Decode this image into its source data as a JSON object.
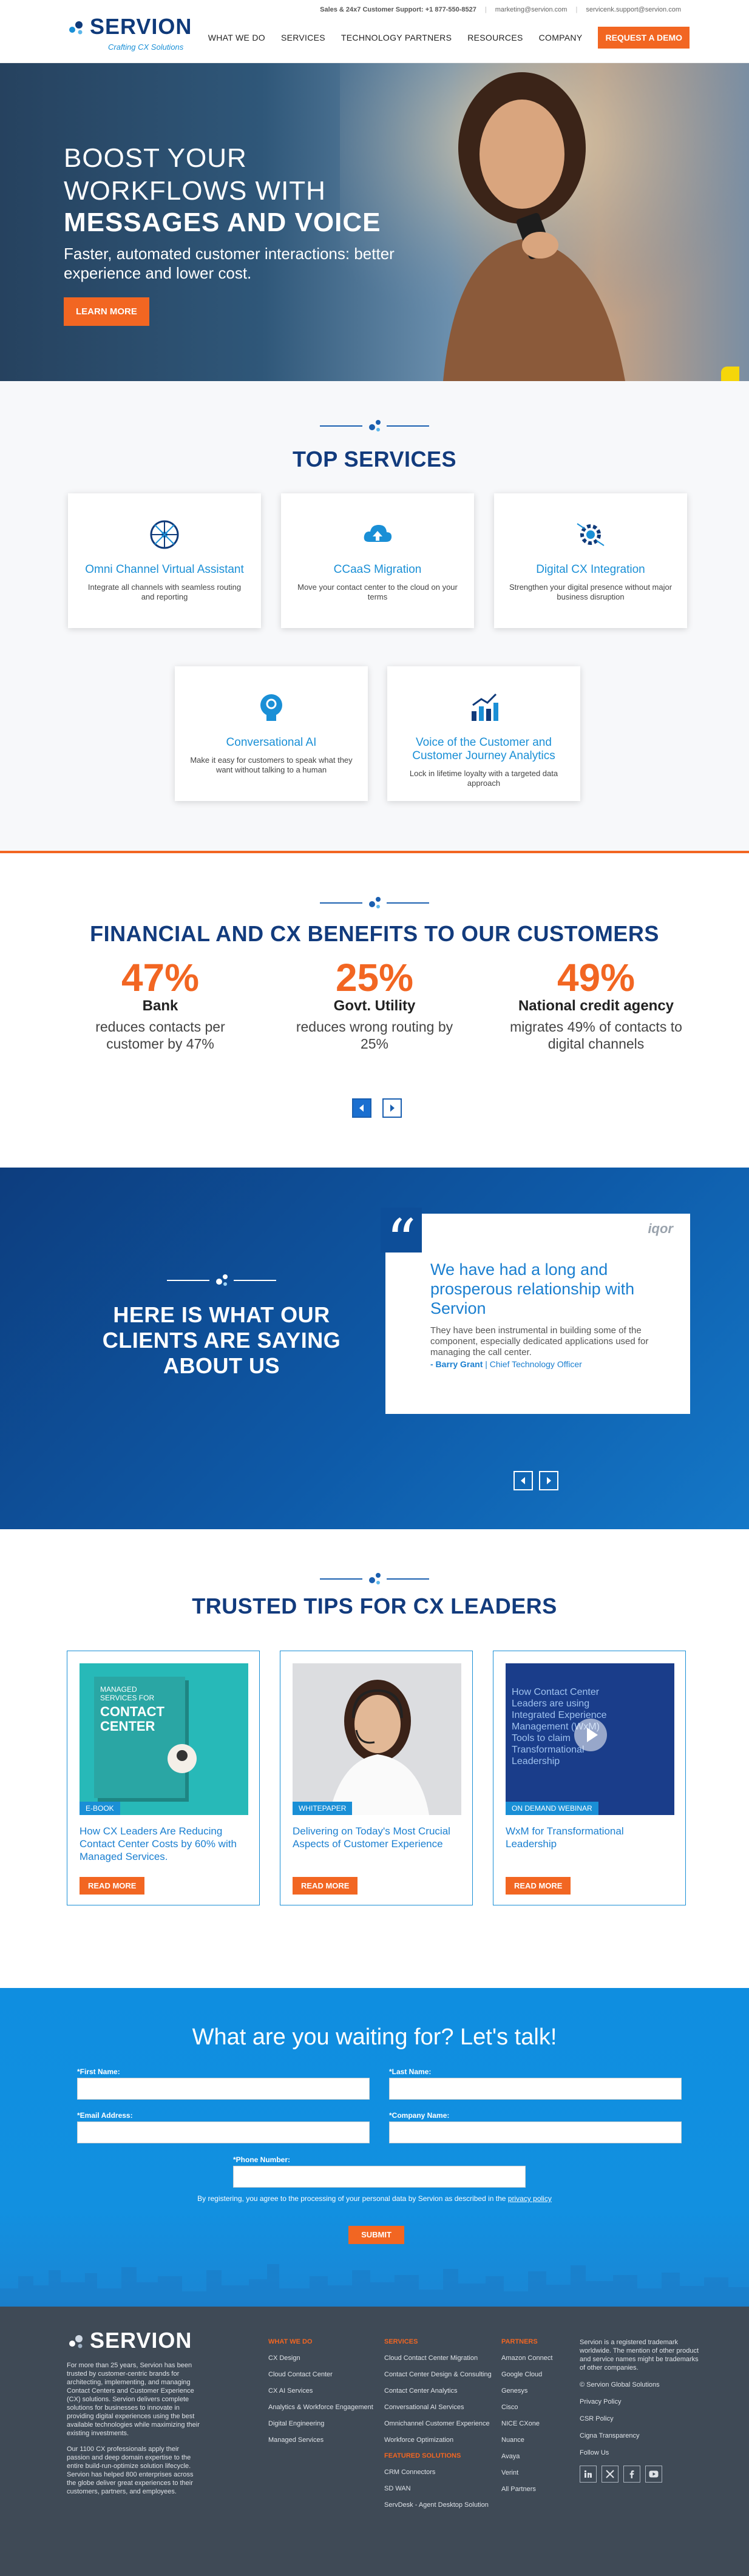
{
  "header": {
    "brand": "SERVION",
    "tagline": "Crafting CX Solutions",
    "topbar": {
      "sales": "Sales & 24x7 Customer Support: +1 877-550-8527",
      "email": "marketing@servion.com",
      "support_email": "servicenk.support@servion.com"
    },
    "nav": [
      "WHAT WE DO",
      "SERVICES",
      "TECHNOLOGY PARTNERS",
      "RESOURCES",
      "COMPANY"
    ],
    "cta": "REQUEST A DEMO"
  },
  "hero": {
    "line1a": "BOOST YOUR",
    "line1b": "WORKFLOWS WITH",
    "line2": "MESSAGES AND VOICE",
    "subtitle": "Faster, automated customer interactions: better experience and lower cost.",
    "button": "LEARN MORE"
  },
  "services": {
    "title": "TOP SERVICES",
    "items": [
      {
        "title": "Omni Channel Virtual Assistant",
        "desc": "Integrate all channels with seamless routing and reporting",
        "icon": "network-globe-icon"
      },
      {
        "title": "CCaaS Migration",
        "desc": "Move your contact center to the cloud on your terms",
        "icon": "cloud-upload-icon"
      },
      {
        "title": "Digital CX Integration",
        "desc": "Strengthen your digital presence without major business disruption",
        "icon": "gear-circuit-icon"
      },
      {
        "title": "Conversational AI",
        "desc": "Make it easy for customers to speak what they want without talking to a human",
        "icon": "ai-head-icon"
      },
      {
        "title": "Voice of the Customer and Customer Journey Analytics",
        "desc": "Lock in lifetime loyalty with a targeted data approach",
        "icon": "analytics-chart-icon"
      }
    ]
  },
  "benefits": {
    "title": "FINANCIAL AND CX BENEFITS TO OUR CUSTOMERS",
    "items": [
      {
        "pct": "47%",
        "name": "Bank",
        "desc": "reduces contacts per customer by 47%"
      },
      {
        "pct": "25%",
        "name": "Govt. Utility",
        "desc": "reduces wrong routing by 25%"
      },
      {
        "pct": "49%",
        "name": "National credit agency",
        "desc": "migrates 49% of contacts to digital channels"
      }
    ]
  },
  "testimonials": {
    "title": "HERE IS WHAT OUR CLIENTS ARE SAYING ABOUT US",
    "logo": "iqor",
    "headline": "We have had a long and prosperous relationship with Servion",
    "body": "They have been instrumental in building some of the component, especially dedicated applications used for managing the call center.",
    "author": "- Barry Grant",
    "role": "Chief Technology Officer"
  },
  "tips": {
    "title": "TRUSTED TIPS FOR CX LEADERS",
    "items": [
      {
        "badge": "E-BOOK",
        "title": "How CX Leaders Are Reducing Contact Center Costs by 60% with Managed Services.",
        "button": "READ MORE",
        "cover_l1": "MANAGED",
        "cover_l2": "SERVICES FOR",
        "cover_l3": "CONTACT",
        "cover_l4": "CENTER"
      },
      {
        "badge": "WHITEPAPER",
        "title": "Delivering on Today's Most Crucial Aspects of Customer Experience",
        "button": "READ MORE"
      },
      {
        "badge": "ON DEMAND WEBINAR",
        "title": "WxM for Transformational Leadership",
        "button": "READ MORE",
        "video_l1": "How Contact Center",
        "video_l2": "Leaders are using",
        "video_l3": "Integrated Experience",
        "video_l4": "Management (WxM)",
        "video_l5": "Tools to claim",
        "video_l6": "Transformational",
        "video_l7": "Leadership"
      }
    ]
  },
  "contact": {
    "title": "What are you waiting for? Let's talk!",
    "first_name": "*First Name:",
    "last_name": "*Last Name:",
    "email": "*Email Address:",
    "company": "*Company Name:",
    "phone": "*Phone Number:",
    "consent": "By registering, you agree to the processing of your personal data by Servion as described in the",
    "consent_link": "privacy policy",
    "submit": "SUBMIT"
  },
  "footer": {
    "brand": "SERVION",
    "about1": "For more than 25 years, Servion has been trusted by customer-centric brands for architecting, implementing, and managing Contact Centers and Customer Experience (CX) solutions. Servion delivers complete solutions for businesses to innovate in providing digital experiences using the best available technologies while maximizing their existing investments.",
    "about2": "Our 1100 CX professionals apply their passion and deep domain expertise to the entire build-run-optimize solution lifecycle. Servion has helped 800 enterprises across the globe deliver great experiences to their customers, partners, and employees.",
    "col1": {
      "title": "WHAT WE DO",
      "items": [
        "CX Design",
        "Cloud Contact Center",
        "CX AI Services",
        "Analytics & Workforce Engagement",
        "Digital Engineering",
        "Managed Services"
      ]
    },
    "col2": {
      "title": "SERVICES",
      "items": [
        "Cloud Contact Center Migration",
        "Contact Center Design & Consulting",
        "Contact Center Analytics",
        "Conversational AI Services",
        "Omnichannel Customer Experience",
        "Workforce Optimization"
      ],
      "sub_title": "FEATURED SOLUTIONS",
      "sub_items": [
        "CRM Connectors",
        "SD WAN",
        "ServDesk - Agent Desktop Solution"
      ]
    },
    "col3": {
      "title": "PARTNERS",
      "items": [
        "Amazon Connect",
        "Google Cloud",
        "Genesys",
        "Cisco",
        "NICE CXone",
        "Nuance",
        "Avaya",
        "Verint",
        "All Partners"
      ]
    },
    "right": {
      "trademark": "Servion is a registered trademark worldwide. The mention of other product and service names might be trademarks of other companies.",
      "items": [
        "© Servion Global Solutions",
        "Privacy Policy",
        "CSR Policy",
        "Cigna Transparency",
        "Follow Us"
      ]
    }
  },
  "colors": {
    "brand_navy": "#123b7d",
    "brand_blue": "#1a8fd6",
    "accent_orange": "#f26622",
    "footer_bg": "#3f4a56"
  }
}
